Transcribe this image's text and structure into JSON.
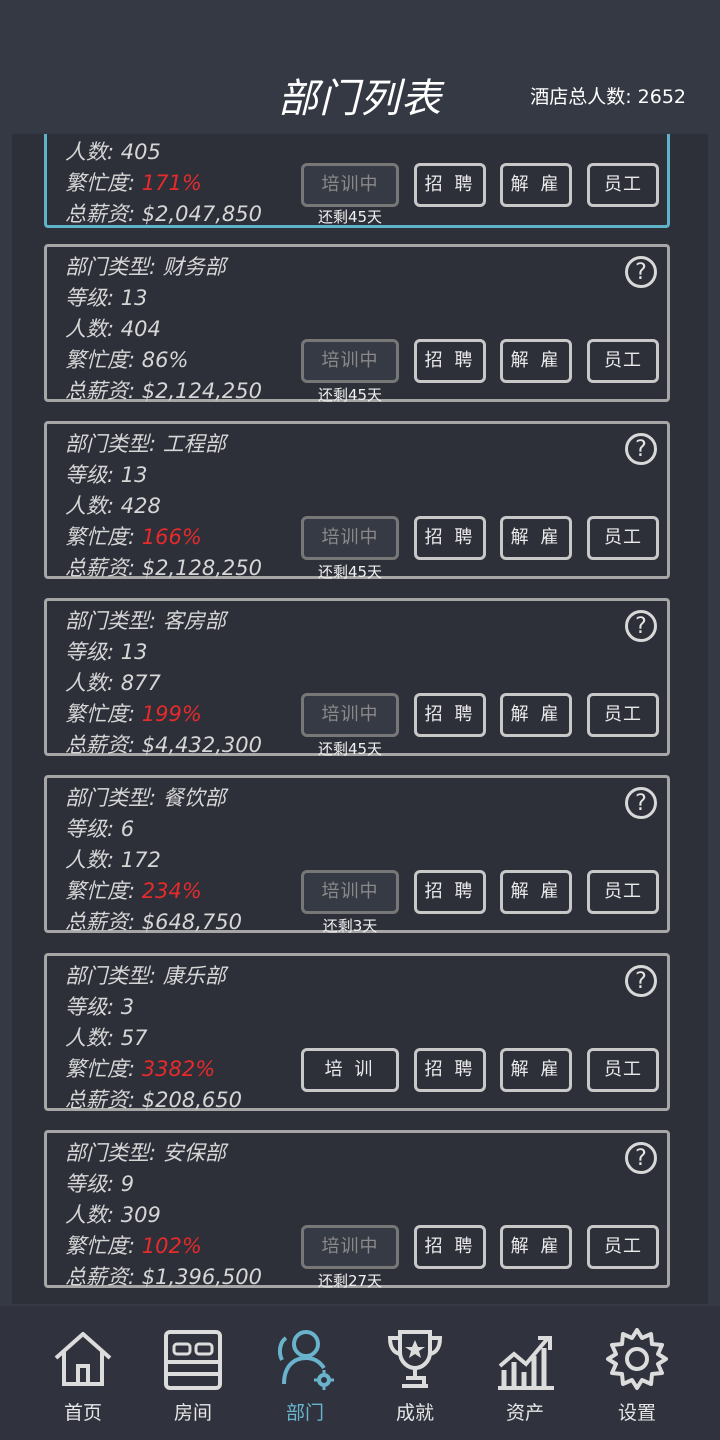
{
  "header": {
    "title": "部门列表",
    "total_label": "酒店总人数: 2652"
  },
  "buttons": {
    "recruit": "招 聘",
    "fire": "解 雇",
    "staff": "员工",
    "train": "培 训",
    "training": "培训中"
  },
  "colors": {
    "accent": "#5eb3c8",
    "busy_over": "#e52b2b"
  },
  "first_card": {
    "count": "人数: 405",
    "busy_label": "繁忙度: ",
    "busy_value": "171%",
    "salary": "总薪资: $2,047,850",
    "remain": "还剩45天"
  },
  "departments": [
    {
      "type": "部门类型: 财务部",
      "level": "等级: 13",
      "count": "人数: 404",
      "busy_label": "繁忙度: ",
      "busy_value": "86%",
      "busy_over": false,
      "salary": "总薪资: $2,124,250",
      "training": true,
      "remain": "还剩45天"
    },
    {
      "type": "部门类型: 工程部",
      "level": "等级: 13",
      "count": "人数: 428",
      "busy_label": "繁忙度: ",
      "busy_value": "166%",
      "busy_over": true,
      "salary": "总薪资: $2,128,250",
      "training": true,
      "remain": "还剩45天"
    },
    {
      "type": "部门类型: 客房部",
      "level": "等级: 13",
      "count": "人数: 877",
      "busy_label": "繁忙度: ",
      "busy_value": "199%",
      "busy_over": true,
      "salary": "总薪资: $4,432,300",
      "training": true,
      "remain": "还剩45天"
    },
    {
      "type": "部门类型: 餐饮部",
      "level": "等级: 6",
      "count": "人数: 172",
      "busy_label": "繁忙度: ",
      "busy_value": "234%",
      "busy_over": true,
      "salary": "总薪资: $648,750",
      "training": true,
      "remain": "还剩3天"
    },
    {
      "type": "部门类型: 康乐部",
      "level": "等级: 3",
      "count": "人数: 57",
      "busy_label": "繁忙度: ",
      "busy_value": "3382%",
      "busy_over": true,
      "salary": "总薪资: $208,650",
      "training": false,
      "remain": ""
    },
    {
      "type": "部门类型: 安保部",
      "level": "等级: 9",
      "count": "人数: 309",
      "busy_label": "繁忙度: ",
      "busy_value": "102%",
      "busy_over": true,
      "salary": "总薪资: $1,396,500",
      "training": true,
      "remain": "还剩27天"
    }
  ],
  "nav": [
    {
      "label": "首页",
      "icon": "home-icon",
      "active": false
    },
    {
      "label": "房间",
      "icon": "bed-icon",
      "active": false
    },
    {
      "label": "部门",
      "icon": "users-gear-icon",
      "active": true
    },
    {
      "label": "成就",
      "icon": "trophy-icon",
      "active": false
    },
    {
      "label": "资产",
      "icon": "chart-icon",
      "active": false
    },
    {
      "label": "设置",
      "icon": "gear-icon",
      "active": false
    }
  ]
}
